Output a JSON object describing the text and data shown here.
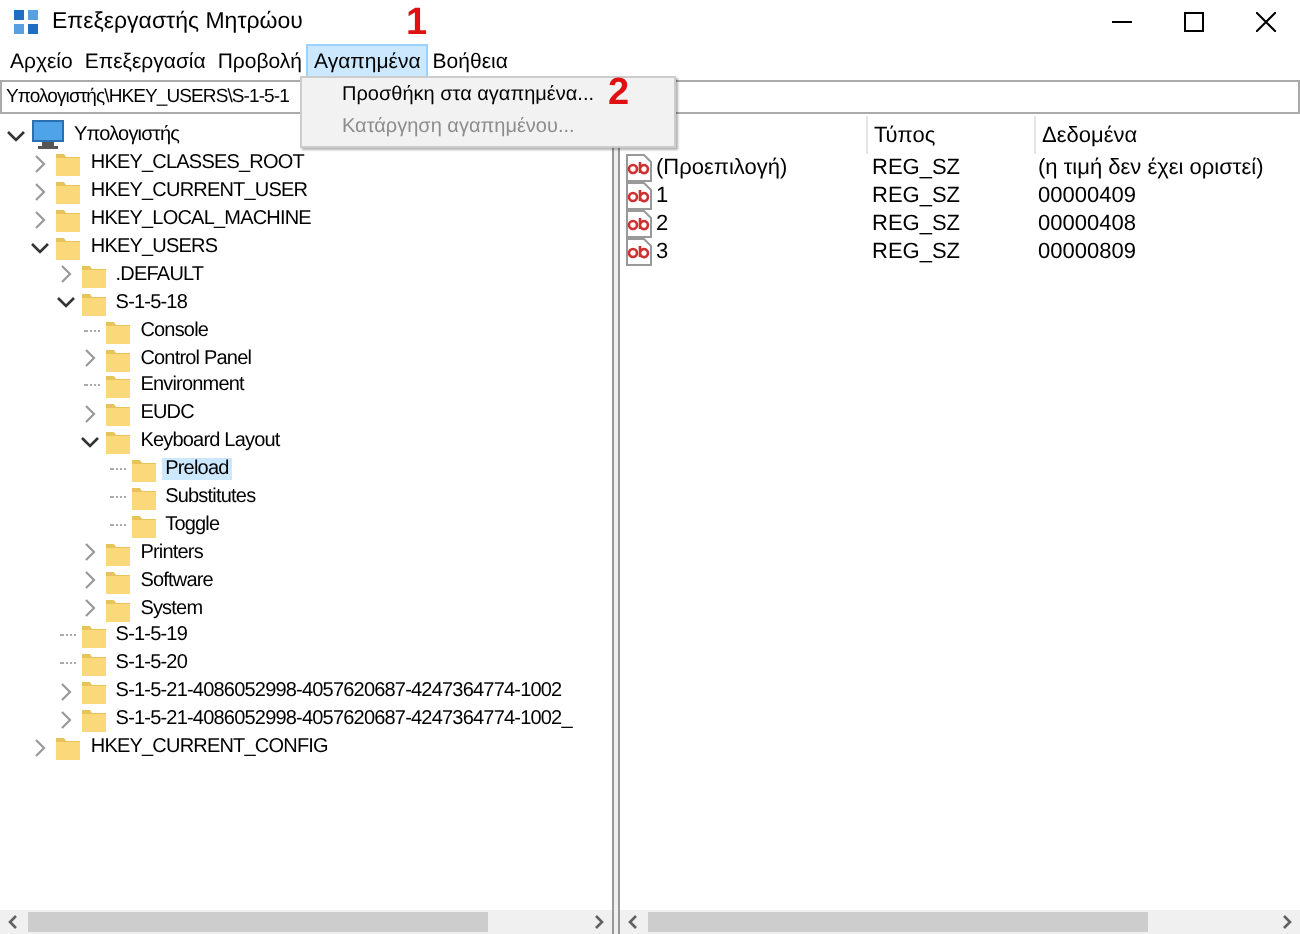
{
  "window": {
    "title": "Επεξεργαστής Μητρώου"
  },
  "menu_bar": [
    {
      "label": "Αρχείο",
      "selected": false
    },
    {
      "label": "Επεξεργασία",
      "selected": false
    },
    {
      "label": "Προβολή",
      "selected": false
    },
    {
      "label": "Αγαπημένα",
      "selected": true
    },
    {
      "label": "Βοήθεια",
      "selected": false
    }
  ],
  "address_bar": {
    "value": "Υπολογιστής\\HKEY_USERS\\S-1-5-1"
  },
  "dropdown_menu": {
    "items": [
      {
        "label": "Προσθήκη στα αγαπημένα...",
        "disabled": false
      },
      {
        "label": "Κατάργηση αγαπημένου...",
        "disabled": true
      }
    ]
  },
  "tree": [
    {
      "label": "Υπολογιστής",
      "kind": "branch",
      "expanded": true,
      "selected": false,
      "children": [
        {
          "label": "HKEY_CLASSES_ROOT",
          "kind": "branch",
          "expanded": false,
          "selected": false
        },
        {
          "label": "HKEY_CURRENT_USER",
          "kind": "branch",
          "expanded": false,
          "selected": false
        },
        {
          "label": "HKEY_LOCAL_MACHINE",
          "kind": "branch",
          "expanded": false,
          "selected": false
        },
        {
          "label": "HKEY_USERS",
          "kind": "branch",
          "expanded": true,
          "selected": false,
          "children": [
            {
              "label": ".DEFAULT",
              "kind": "branch",
              "expanded": false,
              "selected": false
            },
            {
              "label": "S-1-5-18",
              "kind": "branch",
              "expanded": true,
              "selected": false,
              "children": [
                {
                  "label": "Console",
                  "kind": "leaf",
                  "selected": false
                },
                {
                  "label": "Control Panel",
                  "kind": "branch",
                  "expanded": false,
                  "selected": false
                },
                {
                  "label": "Environment",
                  "kind": "leaf",
                  "selected": false
                },
                {
                  "label": "EUDC",
                  "kind": "branch",
                  "expanded": false,
                  "selected": false
                },
                {
                  "label": "Keyboard Layout",
                  "kind": "branch",
                  "expanded": true,
                  "selected": false,
                  "children": [
                    {
                      "label": "Preload",
                      "kind": "leaf",
                      "selected": true
                    },
                    {
                      "label": "Substitutes",
                      "kind": "leaf",
                      "selected": false
                    },
                    {
                      "label": "Toggle",
                      "kind": "leaf",
                      "selected": false
                    }
                  ]
                },
                {
                  "label": "Printers",
                  "kind": "branch",
                  "expanded": false,
                  "selected": false
                },
                {
                  "label": "Software",
                  "kind": "branch",
                  "expanded": false,
                  "selected": false
                },
                {
                  "label": "System",
                  "kind": "branch",
                  "expanded": false,
                  "selected": false
                }
              ]
            },
            {
              "label": "S-1-5-19",
              "kind": "leaf",
              "selected": false
            },
            {
              "label": "S-1-5-20",
              "kind": "leaf",
              "selected": false
            },
            {
              "label": "S-1-5-21-4086052998-4057620687-4247364774-1002",
              "kind": "branch",
              "expanded": false,
              "selected": false
            },
            {
              "label": "S-1-5-21-4086052998-4057620687-4247364774-1002_",
              "kind": "branch",
              "expanded": false,
              "selected": false
            }
          ]
        },
        {
          "label": "HKEY_CURRENT_CONFIG",
          "kind": "branch",
          "expanded": false,
          "selected": false
        }
      ]
    }
  ],
  "table": {
    "columns": [
      {
        "label": "Τύπος"
      },
      {
        "label": "Δεδομένα"
      }
    ],
    "rows": [
      {
        "name": "(Προεπιλογή)",
        "type": "REG_SZ",
        "data": "(η τιμή δεν έχει οριστεί)"
      },
      {
        "name": "1",
        "type": "REG_SZ",
        "data": "00000409"
      },
      {
        "name": "2",
        "type": "REG_SZ",
        "data": "00000408"
      },
      {
        "name": "3",
        "type": "REG_SZ",
        "data": "00000809"
      }
    ]
  },
  "annotations": [
    {
      "label": "1"
    },
    {
      "label": "2"
    }
  ]
}
